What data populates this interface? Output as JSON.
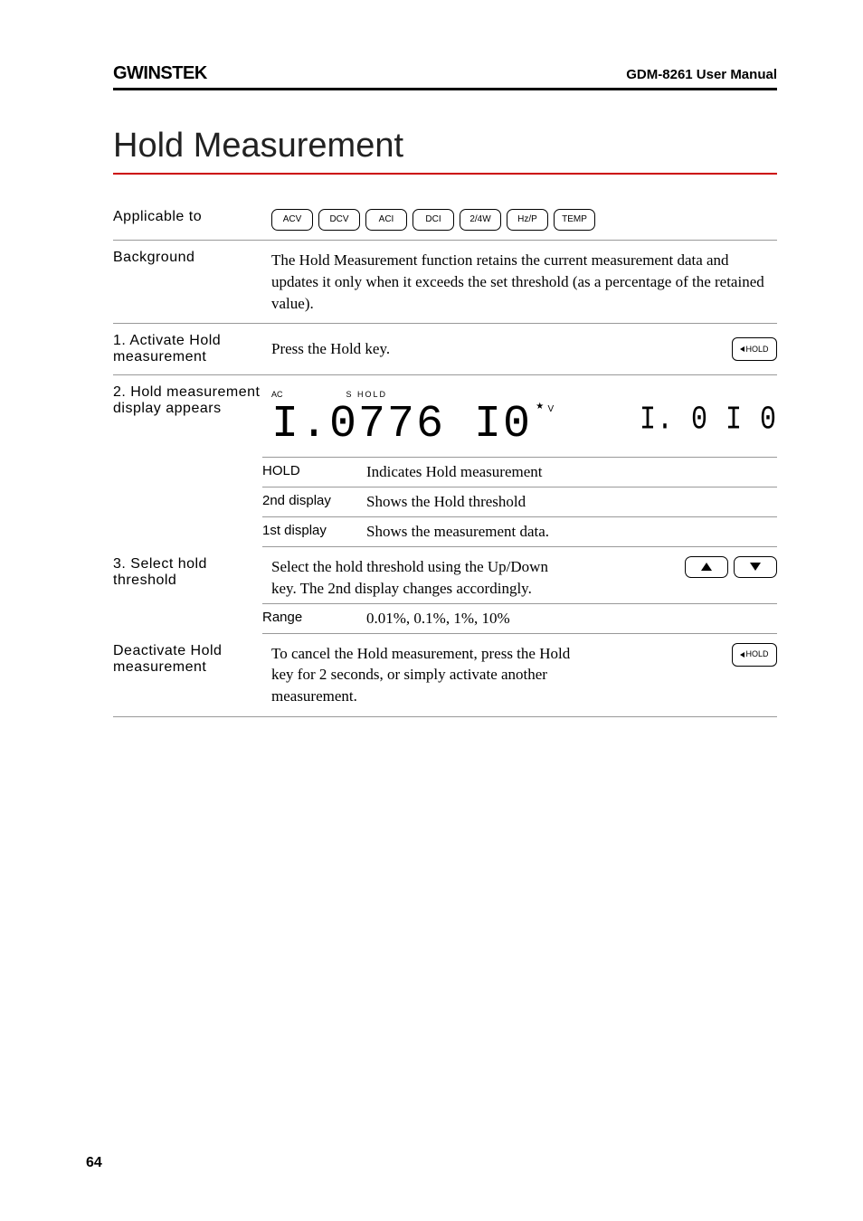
{
  "header": {
    "logo": "GWINSTEK",
    "manual": "GDM-8261 User Manual"
  },
  "title": "Hold Measurement",
  "applicable": {
    "label": "Applicable to",
    "buttons": [
      "ACV",
      "DCV",
      "ACI",
      "DCI",
      "2/4W",
      "Hz/P",
      "TEMP"
    ]
  },
  "background": {
    "label": "Background",
    "text": "The Hold Measurement function retains the current measurement data and updates it only when it exceeds the set threshold (as a percentage of the retained value)."
  },
  "step1": {
    "label": "1. Activate Hold measurement",
    "text": "Press the Hold key.",
    "key": "HOLD"
  },
  "step2": {
    "label": "2. Hold measurement display appears",
    "disp": {
      "ac": "AC",
      "s_hold": "S  HOLD",
      "main": "I.0776 I0",
      "unit": "V",
      "star": "★",
      "second": "I. 0 I 0"
    },
    "rows": {
      "hold_l": "HOLD",
      "hold_t": "Indicates Hold measurement",
      "d2_l": "2nd display",
      "d2_t": "Shows the Hold threshold",
      "d1_l": "1st display",
      "d1_t": "Shows the measurement data."
    }
  },
  "step3": {
    "label": "3. Select hold threshold",
    "text": "Select the hold threshold using the Up/Down key. The 2nd display changes accordingly.",
    "range_l": "Range",
    "range_t": "0.01%, 0.1%, 1%, 10%"
  },
  "deact": {
    "label": "Deactivate Hold measurement",
    "text": "To cancel the Hold measurement, press the Hold key for 2 seconds, or simply activate another measurement.",
    "key": "HOLD"
  },
  "pagenum": "64"
}
